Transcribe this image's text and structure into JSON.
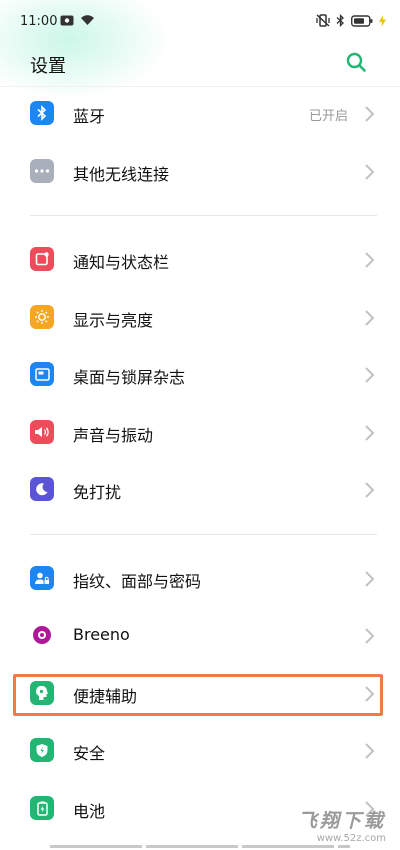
{
  "status_bar": {
    "time": "11:00",
    "icons": [
      "notification-icon",
      "wifi-icon",
      "vibrate-off-icon",
      "bluetooth-icon",
      "battery-icon",
      "charging-bolt-icon"
    ]
  },
  "header": {
    "title": "设置",
    "search_icon": "search-icon"
  },
  "colors": {
    "accent": "#22b573",
    "highlight_border": "#ef7a4a"
  },
  "rows": [
    {
      "id": "bluetooth",
      "label": "蓝牙",
      "value": "已开启",
      "icon": "bluetooth-icon",
      "color": "#1e86f0"
    },
    {
      "id": "other-wireless",
      "label": "其他无线连接",
      "icon": "more-dots-icon",
      "color": "#a9afbb"
    },
    {
      "id": "notifications",
      "label": "通知与状态栏",
      "icon": "notification-icon",
      "color": "#ee4b5b"
    },
    {
      "id": "display",
      "label": "显示与亮度",
      "icon": "brightness-icon",
      "color": "#f6a623"
    },
    {
      "id": "wallpaper",
      "label": "桌面与锁屏杂志",
      "icon": "wallpaper-icon",
      "color": "#1e86f0"
    },
    {
      "id": "sound",
      "label": "声音与振动",
      "icon": "speaker-icon",
      "color": "#ee4b5b"
    },
    {
      "id": "dnd",
      "label": "免打扰",
      "icon": "moon-icon",
      "color": "#5b55d6"
    },
    {
      "id": "biometrics",
      "label": "指纹、面部与密码",
      "icon": "user-lock-icon",
      "color": "#1e86f0"
    },
    {
      "id": "breeno",
      "label": "Breeno",
      "icon": "breeno-icon",
      "color": "#b0179a"
    },
    {
      "id": "accessibility",
      "label": "便捷辅助",
      "icon": "accessibility-icon",
      "color": "#22b573"
    },
    {
      "id": "security",
      "label": "安全",
      "icon": "shield-icon",
      "color": "#22b573"
    },
    {
      "id": "battery",
      "label": "电池",
      "icon": "battery-icon",
      "color": "#22b573"
    }
  ],
  "watermark": {
    "text": "飞翔下载",
    "url": "www.52z.com"
  }
}
